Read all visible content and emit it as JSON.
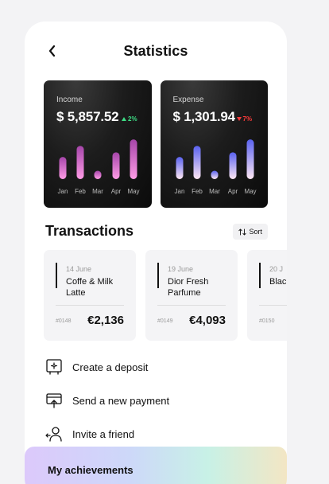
{
  "header": {
    "title": "Statistics",
    "back_icon": "chevron-left-icon"
  },
  "cards": [
    {
      "label": "Income",
      "amount": "$ 5,857.52",
      "change": "2%",
      "direction": "up",
      "months": [
        "Jan",
        "Feb",
        "Mar",
        "Apr",
        "May"
      ],
      "values": [
        0.48,
        0.72,
        0.18,
        0.58,
        0.86
      ],
      "gradient": [
        "#ff9ce6",
        "#a545a9"
      ]
    },
    {
      "label": "Expense",
      "amount": "$ 1,301.94",
      "change": "7%",
      "direction": "down",
      "months": [
        "Jan",
        "Feb",
        "Mar",
        "Apr",
        "May"
      ],
      "values": [
        0.48,
        0.72,
        0.18,
        0.58,
        0.86
      ],
      "gradient": [
        "#fde6f2",
        "#5a62f0"
      ]
    }
  ],
  "transactions": {
    "title": "Transactions",
    "sort_label": "Sort",
    "items": [
      {
        "date": "14 June",
        "name": "Coffe & Milk Latte",
        "id": "#0148",
        "amount": "€2,136"
      },
      {
        "date": "19 June",
        "name": "Dior Fresh Parfume",
        "id": "#0149",
        "amount": "€4,093"
      },
      {
        "date": "20 J",
        "name": "Blac and",
        "id": "#0150",
        "amount": ""
      }
    ]
  },
  "actions": [
    {
      "label": "Create a deposit",
      "icon": "deposit-icon"
    },
    {
      "label": "Send a new payment",
      "icon": "payment-icon"
    },
    {
      "label": "Invite a friend",
      "icon": "invite-friend-icon"
    }
  ],
  "achievements": {
    "label": "My achievements"
  }
}
